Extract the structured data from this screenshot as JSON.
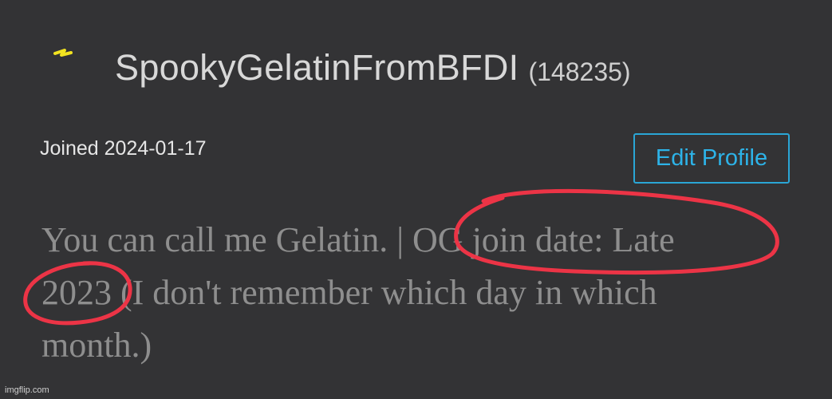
{
  "profile": {
    "username": "SpookyGelatinFromBFDI",
    "user_id": "(148235)",
    "badge_icon": "lightning-bolt-icon",
    "badge_color": "#f2e320",
    "joined": "Joined 2024-01-17"
  },
  "actions": {
    "edit_profile_label": "Edit Profile",
    "accent_color": "#2db3e8"
  },
  "bio": {
    "line1_part1": "You can call me Gelatin. | ",
    "line1_part2": "OG join date: Late",
    "line2_part1": "2023",
    "line2_part2": " (I don't remember which day in which",
    "line3": "month.)"
  },
  "annotations": {
    "circle_color": "#ec3446"
  },
  "watermark": "imgflip.com"
}
